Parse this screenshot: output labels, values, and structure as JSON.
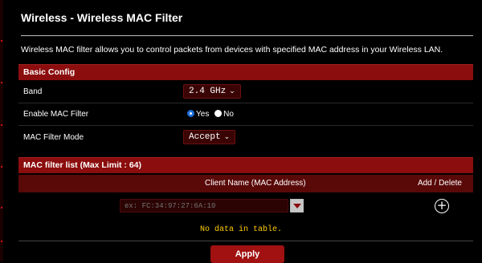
{
  "page": {
    "title": "Wireless - Wireless MAC Filter",
    "description": "Wireless MAC filter allows you to control packets from devices with specified MAC address in your Wireless LAN."
  },
  "basic_config": {
    "heading": "Basic Config",
    "band": {
      "label": "Band",
      "value": "2.4 GHz"
    },
    "enable_mac_filter": {
      "label": "Enable MAC Filter",
      "options": [
        "Yes",
        "No"
      ],
      "selected": "Yes"
    },
    "mac_filter_mode": {
      "label": "MAC Filter Mode",
      "value": "Accept"
    }
  },
  "mac_list": {
    "heading": "MAC filter list (Max Limit : 64)",
    "columns": [
      "Client Name (MAC Address)",
      "Add / Delete"
    ],
    "input_placeholder": "ex: FC:34:97:27:6A:10",
    "empty_text": "No data in table."
  },
  "actions": {
    "apply_label": "Apply"
  },
  "colors": {
    "background": "#000000",
    "section_header": "#8b0d0d",
    "table_header": "#5a0909",
    "accent_text": "#ffcc00",
    "apply_button": "#a11111",
    "radio_selected": "#1e6fd9"
  },
  "icons": {
    "dropdown": "chevron-down-icon",
    "add": "plus-circle-icon",
    "mac_dropdown": "triangle-down-icon"
  }
}
